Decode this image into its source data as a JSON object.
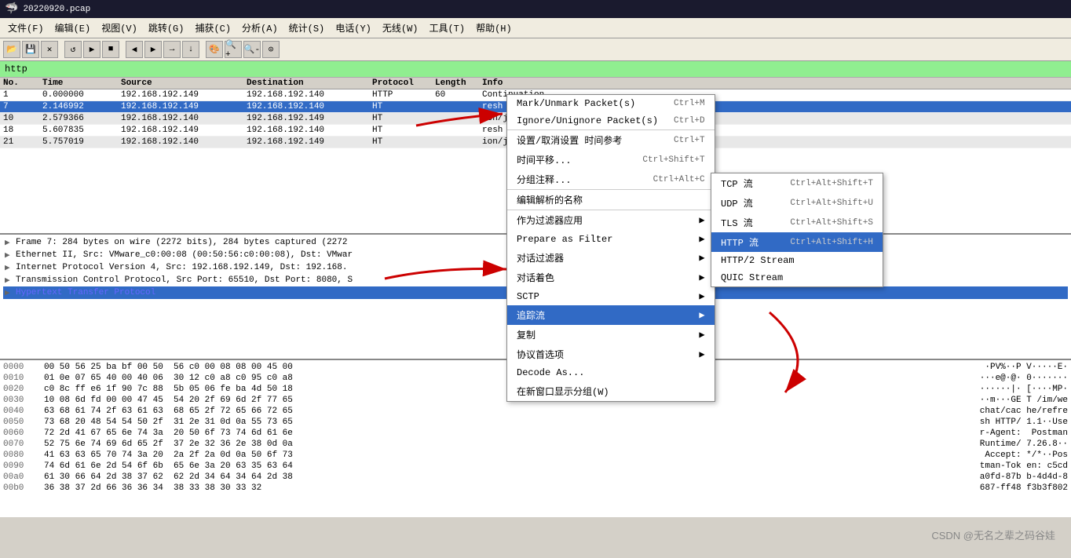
{
  "titleBar": {
    "icon": "shark-icon",
    "title": "20220920.pcap"
  },
  "menuBar": {
    "items": [
      "文件(F)",
      "编辑(E)",
      "视图(V)",
      "跳转(G)",
      "捕获(C)",
      "分析(A)",
      "统计(S)",
      "电话(Y)",
      "无线(W)",
      "工具(T)",
      "帮助(H)"
    ]
  },
  "filter": {
    "value": "http"
  },
  "packets": {
    "headers": [
      "No.",
      "Time",
      "Source",
      "Destination",
      "Protocol",
      "Length",
      "Info"
    ],
    "rows": [
      {
        "no": "1",
        "time": "0.000000",
        "src": "192.168.192.149",
        "dst": "192.168.192.140",
        "proto": "HTTP",
        "len": "60",
        "info": "Continuation",
        "style": "normal"
      },
      {
        "no": "7",
        "time": "2.146992",
        "src": "192.168.192.149",
        "dst": "192.168.192.140",
        "proto": "HT",
        "len": "",
        "info": "resh HTTP/1.1",
        "style": "selected"
      },
      {
        "no": "10",
        "time": "2.579366",
        "src": "192.168.192.140",
        "dst": "192.168.192.149",
        "proto": "HT",
        "len": "",
        "info": "ion/json)",
        "style": "gray"
      },
      {
        "no": "18",
        "time": "5.607835",
        "src": "192.168.192.149",
        "dst": "192.168.192.140",
        "proto": "HT",
        "len": "",
        "info": "resh HTTP/1.1",
        "style": "normal"
      },
      {
        "no": "21",
        "time": "5.757019",
        "src": "192.168.192.140",
        "dst": "192.168.192.149",
        "proto": "HT",
        "len": "",
        "info": "ion/json)",
        "style": "gray"
      }
    ]
  },
  "details": [
    {
      "text": "Frame 7: 284 bytes on wire (2272 bits), 284 bytes captured (2272",
      "expanded": false,
      "color": "black"
    },
    {
      "text": "Ethernet II, Src: VMware_c0:00:08 (00:50:56:c0:00:08), Dst: VMwar",
      "expanded": false,
      "color": "blue",
      "label": "Ethernet"
    },
    {
      "text": "Internet Protocol Version 4, Src: 192.168.192.149, Dst: 192.168.",
      "expanded": false,
      "color": "black"
    },
    {
      "text": "Transmission Control Protocol, Src Port: 65510, Dst Port: 8080, S",
      "expanded": false,
      "color": "black"
    },
    {
      "text": "Hypertext Transfer Protocol",
      "expanded": false,
      "color": "blue",
      "selected": true
    }
  ],
  "hexRows": [
    {
      "offset": "0000",
      "bytes": "00 50 56 25 ba bf 00 50  56 c0 00 08 08 00 45 00",
      "ascii": "·PV%··P V·····E·"
    },
    {
      "offset": "0010",
      "bytes": "01 0e 07 65 40 00 40 06  30 12 c0 a8 c0 95 c0 a8",
      "ascii": "···e@·@· 0·······"
    },
    {
      "offset": "0020",
      "bytes": "c0 8c ff e6 1f 90 7c 88  5b 05 06 fe ba 4d 50 18",
      "ascii": "······|· [····MP·"
    },
    {
      "offset": "0030",
      "bytes": "10 08 6d fd 00 00 47 45  54 20 2f 69 6d 2f 77 65",
      "ascii": "··m···GE T /im/we"
    },
    {
      "offset": "0040",
      "bytes": "63 68 61 74 2f 63 61 63  68 65 2f 72 65 66 72 65",
      "ascii": "chat/cac he/refre"
    },
    {
      "offset": "0050",
      "bytes": "73 68 20 48 54 54 50 2f  31 2e 31 0d 0a 55 73 65",
      "ascii": "sh HTTP/ 1.1··Use"
    },
    {
      "offset": "0060",
      "bytes": "72 2d 41 67 65 6e 74 3a  20 50 6f 73 74 6d 61 6e",
      "ascii": "r-Agent:  Postman"
    },
    {
      "offset": "0070",
      "bytes": "52 75 6e 74 69 6d 65 2f  37 2e 32 36 2e 38 0d 0a",
      "ascii": "Runtime/ 7.26.8··"
    },
    {
      "offset": "0080",
      "bytes": "41 63 63 65 70 74 3a 20  2a 2f 2a 0d 0a 50 6f 73",
      "ascii": "Accept: */*··Pos"
    },
    {
      "offset": "0090",
      "bytes": "74 6d 61 6e 2d 54 6f 6b  65 6e 3a 20 63 35 63 64",
      "ascii": "tman-Tok en: c5cd"
    },
    {
      "offset": "00a0",
      "bytes": "61 30 66 64 2d 38 37 62  62 2d 34 64 34 64 2d 38",
      "ascii": "a0fd-87b b-4d4d-8"
    },
    {
      "offset": "00b0",
      "bytes": "36 38 37 2d 66 36 36 34  38 33 38 30 33 32",
      "ascii": "687-ff48 f3b3f802"
    }
  ],
  "contextMenu": {
    "items": [
      {
        "label": "Mark/Unmark Packet(s)",
        "shortcut": "Ctrl+M"
      },
      {
        "label": "Ignore/Unignore Packet(s)",
        "shortcut": "Ctrl+D"
      },
      {
        "label": "设置/取消设置 时间参考",
        "shortcut": "Ctrl+T"
      },
      {
        "label": "时间平移...",
        "shortcut": "Ctrl+Shift+T"
      },
      {
        "label": "分组注释...",
        "shortcut": "Ctrl+Alt+C"
      },
      {
        "label": "编辑解析的名称",
        "shortcut": ""
      },
      {
        "label": "作为过滤器应用",
        "shortcut": "",
        "hasSubmenu": true
      },
      {
        "label": "Prepare as Filter",
        "shortcut": "",
        "hasSubmenu": true
      },
      {
        "label": "对话过滤器",
        "shortcut": "",
        "hasSubmenu": true
      },
      {
        "label": "对话着色",
        "shortcut": "",
        "hasSubmenu": true
      },
      {
        "label": "SCTP",
        "shortcut": "",
        "hasSubmenu": true
      },
      {
        "label": "追踪流",
        "shortcut": "",
        "hasSubmenu": true,
        "highlighted": true
      },
      {
        "label": "复制",
        "shortcut": "",
        "hasSubmenu": true
      },
      {
        "label": "协议首选项",
        "shortcut": "",
        "hasSubmenu": true
      },
      {
        "label": "Decode As...",
        "shortcut": ""
      },
      {
        "label": "在新窗口显示分组(W)",
        "shortcut": ""
      }
    ]
  },
  "submenu": {
    "items": [
      {
        "label": "TCP 流",
        "shortcut": "Ctrl+Alt+Shift+T"
      },
      {
        "label": "UDP 流",
        "shortcut": "Ctrl+Alt+Shift+U"
      },
      {
        "label": "TLS 流",
        "shortcut": "Ctrl+Alt+Shift+S"
      },
      {
        "label": "HTTP 流",
        "shortcut": "Ctrl+Alt+Shift+H"
      },
      {
        "label": "HTTP/2 Stream",
        "shortcut": ""
      },
      {
        "label": "QUIC Stream",
        "shortcut": ""
      }
    ]
  },
  "watermark": "CSDN @无名之辈之码谷娃"
}
